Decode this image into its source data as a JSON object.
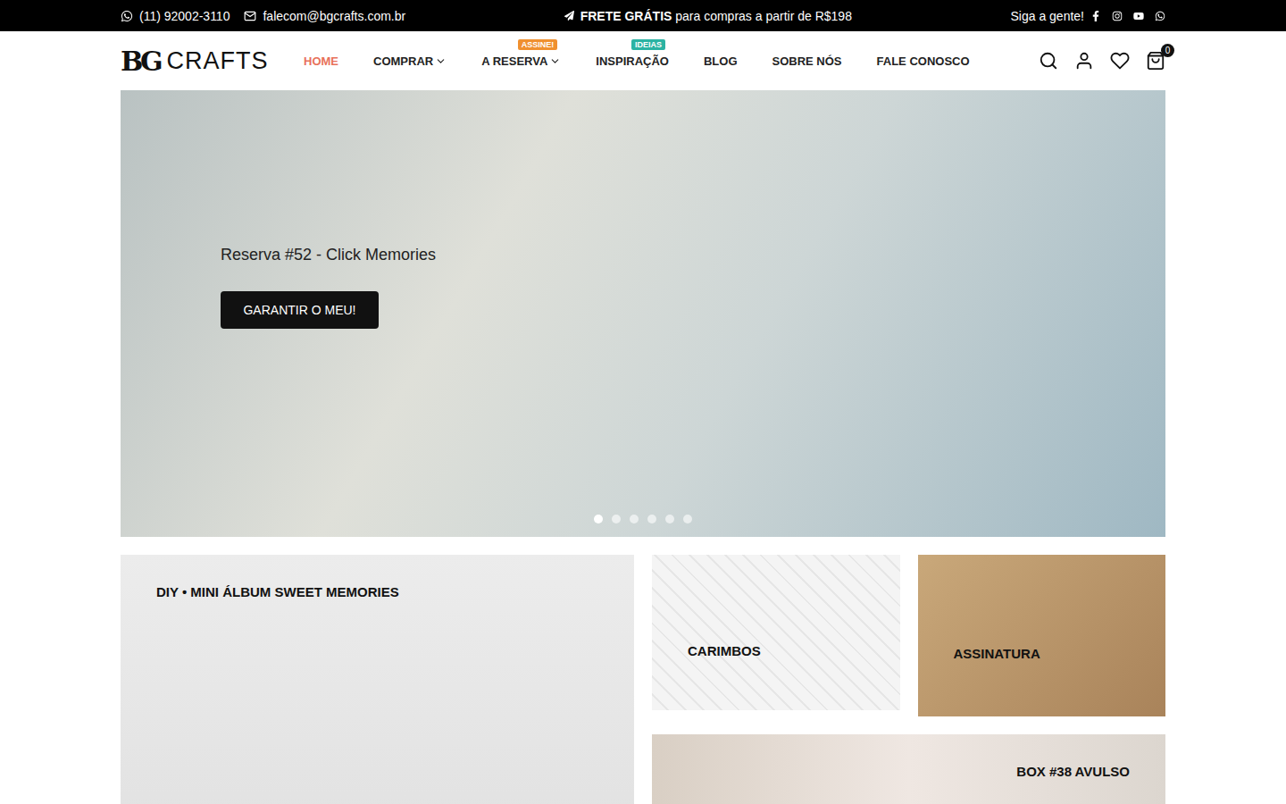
{
  "topbar": {
    "phone": "(11) 92002-3110",
    "email": "falecom@bgcrafts.com.br",
    "promo_bold": "FRETE GRÁTIS",
    "promo_rest": "para compras a partir de R$198",
    "follow": "Siga a gente!"
  },
  "logo": {
    "mark": "BG",
    "name": "CRAFTS"
  },
  "nav": [
    {
      "label": "HOME",
      "selected": true,
      "dropdown": false,
      "badge": "",
      "color": ""
    },
    {
      "label": "COMPRAR",
      "selected": false,
      "dropdown": true,
      "badge": "",
      "color": ""
    },
    {
      "label": "A RESERVA",
      "selected": false,
      "dropdown": true,
      "badge": "ASSINE!",
      "color": "#f0902f"
    },
    {
      "label": "INSPIRAÇÃO",
      "selected": false,
      "dropdown": false,
      "badge": "IDEIAS",
      "color": "#2bb3a3"
    },
    {
      "label": "BLOG",
      "selected": false,
      "dropdown": false,
      "badge": "",
      "color": ""
    },
    {
      "label": "SOBRE NÓS",
      "selected": false,
      "dropdown": false,
      "badge": "",
      "color": ""
    },
    {
      "label": "FALE CONOSCO",
      "selected": false,
      "dropdown": false,
      "badge": "",
      "color": ""
    }
  ],
  "cart": {
    "count": "0"
  },
  "hero": {
    "title": "Reserva #52 - Click Memories",
    "button": "GARANTIR O MEU!",
    "dots": [
      {
        "selected": true
      },
      {
        "selected": false
      },
      {
        "selected": false
      },
      {
        "selected": false
      },
      {
        "selected": false
      },
      {
        "selected": false
      }
    ]
  },
  "feature": {
    "title": "DIY • MINI ÁLBUM SWEET MEMORIES"
  },
  "tiles": [
    {
      "title": "CARIMBOS"
    },
    {
      "title": "ASSINATURA"
    }
  ],
  "banner": {
    "title": "BOX #38 AVULSO"
  }
}
